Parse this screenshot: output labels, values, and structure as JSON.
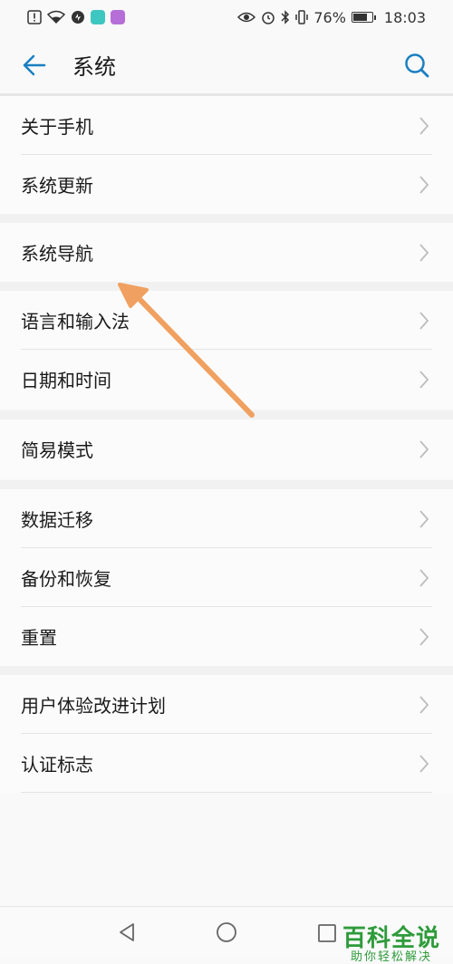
{
  "status_bar": {
    "battery_percent": "76%",
    "battery_level": 0.76,
    "time": "18:03",
    "left_icons": [
      "alert-icon",
      "wifi-icon",
      "speed-icon",
      "app-badge-teal-icon",
      "app-badge-purple-icon"
    ],
    "right_icons": [
      "eye-icon",
      "alarm-icon",
      "bluetooth-icon",
      "vibrate-icon"
    ],
    "colors": {
      "teal_badge": "#3ec6c0",
      "purple_badge": "#b56fd6"
    }
  },
  "header": {
    "title": "系统"
  },
  "groups": [
    {
      "items": [
        {
          "label": "关于手机"
        },
        {
          "label": "系统更新"
        }
      ]
    },
    {
      "items": [
        {
          "label": "系统导航"
        }
      ]
    },
    {
      "items": [
        {
          "label": "语言和输入法"
        },
        {
          "label": "日期和时间"
        }
      ]
    },
    {
      "items": [
        {
          "label": "简易模式"
        }
      ]
    },
    {
      "items": [
        {
          "label": "数据迁移"
        },
        {
          "label": "备份和恢复"
        },
        {
          "label": "重置"
        }
      ]
    },
    {
      "items": [
        {
          "label": "用户体验改进计划"
        },
        {
          "label": "认证标志"
        }
      ]
    }
  ],
  "watermark": {
    "title": "百科全说",
    "subtitle": "助你轻松解决"
  },
  "colors": {
    "accent": "#1a7fc1",
    "annotation_arrow": "#f0a060"
  }
}
